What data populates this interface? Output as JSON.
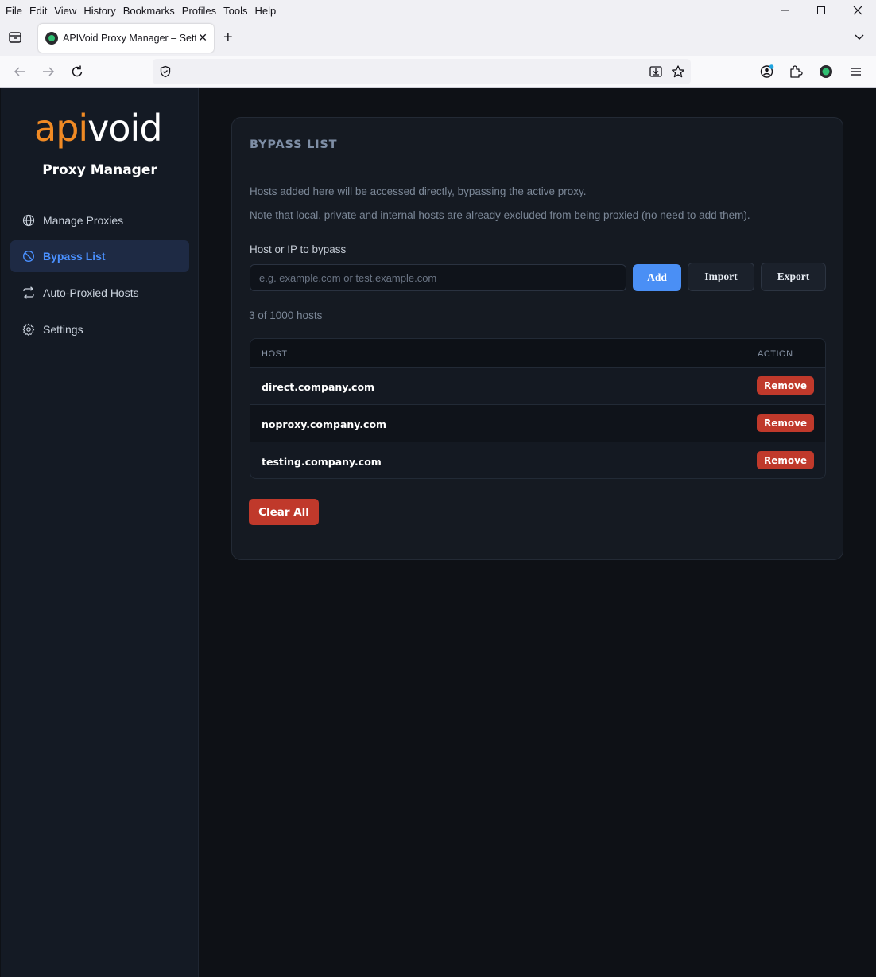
{
  "browser": {
    "menu": [
      "File",
      "Edit",
      "View",
      "History",
      "Bookmarks",
      "Profiles",
      "Tools",
      "Help"
    ],
    "tab_title": "APIVoid Proxy Manager – Settings",
    "url": ""
  },
  "sidebar": {
    "logo_api": "api",
    "logo_void": "void",
    "app_title": "Proxy Manager",
    "items": [
      {
        "label": "Manage Proxies",
        "icon": "globe-icon",
        "active": false
      },
      {
        "label": "Bypass List",
        "icon": "ban-icon",
        "active": true
      },
      {
        "label": "Auto-Proxied Hosts",
        "icon": "arrows-cycle-icon",
        "active": false
      },
      {
        "label": "Settings",
        "icon": "gear-icon",
        "active": false
      }
    ]
  },
  "main": {
    "title": "BYPASS LIST",
    "desc1": "Hosts added here will be accessed directly, bypassing the active proxy.",
    "desc2": "Note that local, private and internal hosts are already excluded from being proxied (no need to add them).",
    "field_label": "Host or IP to bypass",
    "input_placeholder": "e.g. example.com or test.example.com",
    "input_value": "",
    "add_label": "Add",
    "import_label": "Import",
    "export_label": "Export",
    "count_text": "3 of 1000 hosts",
    "table": {
      "headers": {
        "host": "HOST",
        "action": "ACTION"
      },
      "rows": [
        {
          "host": "direct.company.com",
          "action": "Remove"
        },
        {
          "host": "noproxy.company.com",
          "action": "Remove"
        },
        {
          "host": "testing.company.com",
          "action": "Remove"
        }
      ]
    },
    "clear_label": "Clear All"
  },
  "colors": {
    "accent": "#4a8ff5",
    "danger": "#c0392b",
    "logo_orange": "#f08a24"
  }
}
